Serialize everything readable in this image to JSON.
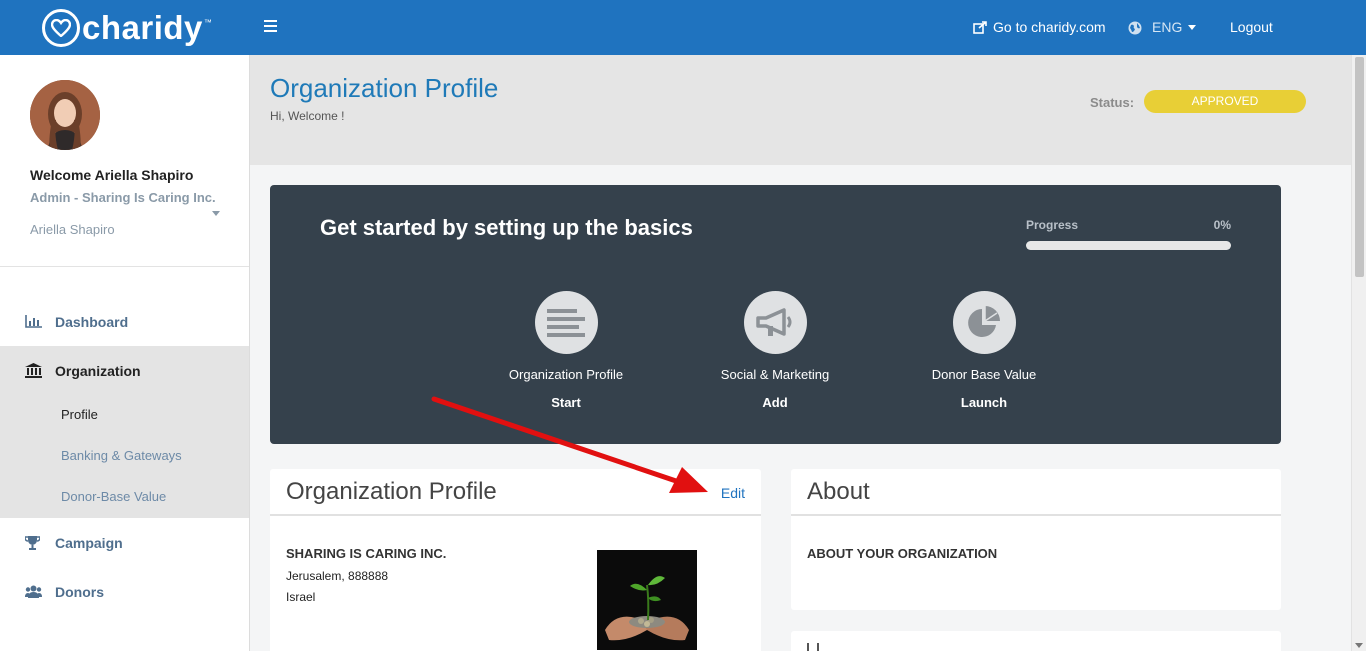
{
  "topbar": {
    "logo_text": "charidy",
    "logo_tm": "™",
    "goto_label": "Go to charidy.com",
    "lang_label": "ENG",
    "logout_label": "Logout"
  },
  "sidebar": {
    "welcome": "Welcome Ariella Shapiro",
    "role": "Admin - Sharing Is Caring Inc.",
    "user_select": "Ariella Shapiro",
    "nav": {
      "dashboard": "Dashboard",
      "organization": "Organization",
      "profile": "Profile",
      "banking": "Banking & Gateways",
      "donor_base": "Donor-Base Value",
      "campaign": "Campaign",
      "donors": "Donors"
    }
  },
  "header": {
    "title": "Organization Profile",
    "subtitle": "Hi, Welcome !",
    "status_label": "Status:",
    "status_value": "APPROVED"
  },
  "setup": {
    "title": "Get started by setting up the basics",
    "progress_label": "Progress",
    "progress_value": "0%",
    "progress_fraction": 0,
    "steps": [
      {
        "label": "Organization Profile",
        "action": "Start",
        "icon": "document-lines-icon"
      },
      {
        "label": "Social & Marketing",
        "action": "Add",
        "icon": "megaphone-icon"
      },
      {
        "label": "Donor Base Value",
        "action": "Launch",
        "icon": "pie-chart-icon"
      }
    ]
  },
  "profile_card": {
    "title": "Organization Profile",
    "edit_label": "Edit",
    "org_name": "SHARING IS CARING INC.",
    "address_line": "Jerusalem, 888888",
    "country": "Israel"
  },
  "about_card": {
    "title": "About",
    "heading": "ABOUT YOUR ORGANIZATION"
  },
  "colors": {
    "topbar": "#1f73bf",
    "title_blue": "#1f7ab8",
    "status_yellow": "#e8cf36",
    "dark_card": "#35414c",
    "arrow_red": "#e11010"
  }
}
